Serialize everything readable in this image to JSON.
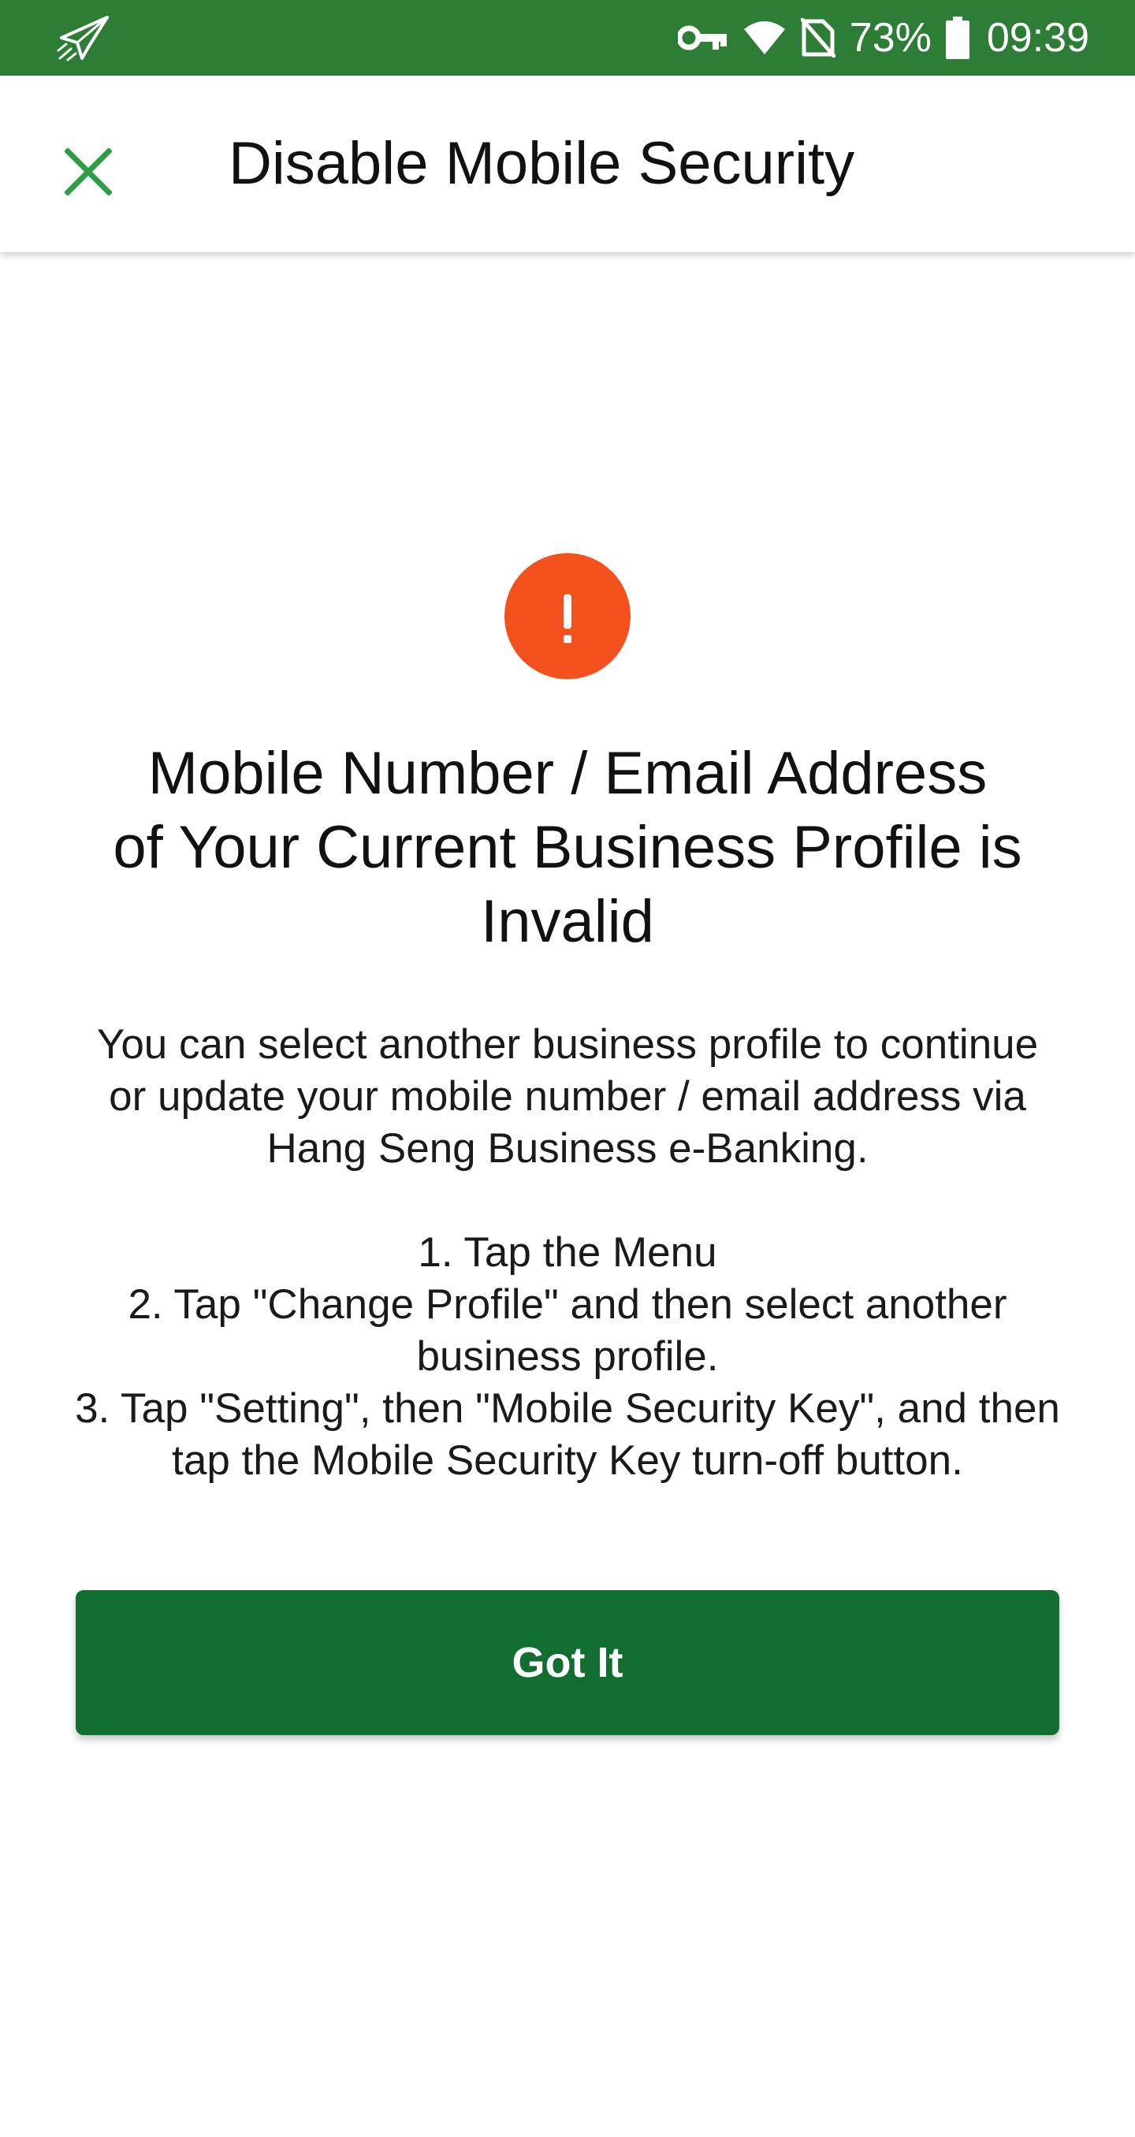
{
  "status_bar": {
    "left_icon": "send-plane-icon",
    "icons": [
      "vpn-key-icon",
      "wifi-icon",
      "no-sim-icon",
      "battery-icon"
    ],
    "battery": "73%",
    "time": "09:39",
    "background": "#2e7d36"
  },
  "app_bar": {
    "close_icon": "close-icon",
    "title": "Disable Mobile Security",
    "accent": "#2e9e44"
  },
  "alert": {
    "icon": "exclamation-icon",
    "color": "#f4511e",
    "headline_lines": [
      "Mobile Number / Email Address",
      "of Your Current Business Profile is",
      "Invalid"
    ],
    "description_lines": [
      "You can select another business profile to continue",
      "or update your mobile number / email address via",
      "Hang Seng Business e-Banking."
    ],
    "steps_lines": [
      "1. Tap the Menu",
      "2. Tap \"Change Profile\" and then select another",
      "business profile.",
      "3. Tap \"Setting\", then \"Mobile Security Key\", and then",
      "tap the Mobile Security Key turn-off button."
    ]
  },
  "actions": {
    "primary_label": "Got It",
    "primary_color": "#116e30"
  }
}
